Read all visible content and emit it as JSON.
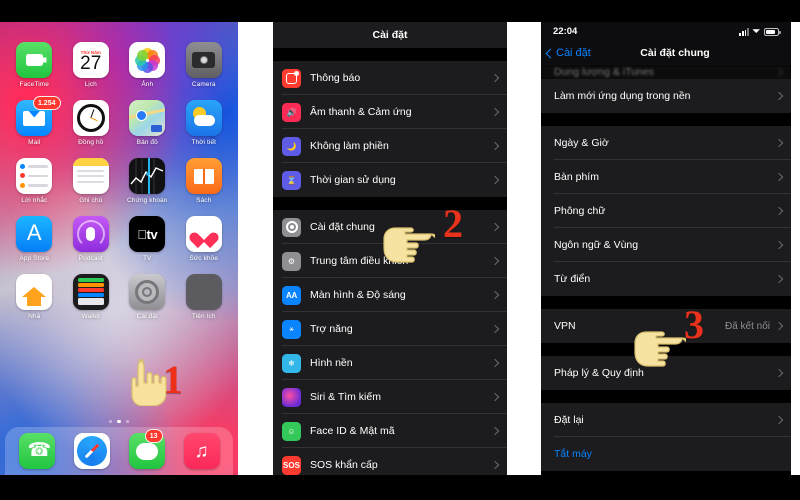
{
  "panel1": {
    "name": "iphone-home-screen",
    "status": {
      "time": ""
    },
    "apps": [
      {
        "label": "FaceTime",
        "icon": "facetime-icon",
        "badge": ""
      },
      {
        "label": "Lịch",
        "icon": "calendar-icon",
        "badge": "",
        "cal_weekday": "Thứ Năm",
        "cal_day": "27"
      },
      {
        "label": "Ảnh",
        "icon": "photos-icon",
        "badge": ""
      },
      {
        "label": "Camera",
        "icon": "camera-icon",
        "badge": ""
      },
      {
        "label": "Mail",
        "icon": "mail-icon",
        "badge": "1.254"
      },
      {
        "label": "Đồng hồ",
        "icon": "clock-icon",
        "badge": ""
      },
      {
        "label": "Bản đồ",
        "icon": "maps-icon",
        "badge": ""
      },
      {
        "label": "Thời tiết",
        "icon": "weather-icon",
        "badge": ""
      },
      {
        "label": "Lời nhắc",
        "icon": "reminders-icon",
        "badge": ""
      },
      {
        "label": "Ghi chú",
        "icon": "notes-icon",
        "badge": ""
      },
      {
        "label": "Chứng khoán",
        "icon": "stocks-icon",
        "badge": ""
      },
      {
        "label": "Sách",
        "icon": "books-icon",
        "badge": ""
      },
      {
        "label": "App Store",
        "icon": "app-store-icon",
        "badge": ""
      },
      {
        "label": "Podcast",
        "icon": "podcasts-icon",
        "badge": ""
      },
      {
        "label": "TV",
        "icon": "apple-tv-icon",
        "badge": ""
      },
      {
        "label": "Sức khỏe",
        "icon": "health-icon",
        "badge": ""
      },
      {
        "label": "Nhà",
        "icon": "home-app-icon",
        "badge": ""
      },
      {
        "label": "Wallet",
        "icon": "wallet-icon",
        "badge": ""
      },
      {
        "label": "Cài đặt",
        "icon": "settings-gear-icon",
        "badge": ""
      },
      {
        "label": "Tiện ích",
        "icon": "utilities-folder-icon",
        "badge": ""
      }
    ],
    "page_dots": {
      "count": 3,
      "active_index": 1
    },
    "dock": [
      {
        "label": "Điện thoại",
        "icon": "phone-icon",
        "badge": ""
      },
      {
        "label": "Safari",
        "icon": "safari-icon",
        "badge": ""
      },
      {
        "label": "Tin nhắn",
        "icon": "messages-icon",
        "badge": "13"
      },
      {
        "label": "Nhạc",
        "icon": "music-icon",
        "badge": ""
      }
    ],
    "step": {
      "number": "1"
    }
  },
  "panel2": {
    "name": "settings-main-screen",
    "navbar": {
      "title": "Cài đặt"
    },
    "groups": [
      {
        "rows": [
          {
            "label": "Thông báo",
            "icon": "notifications-icon",
            "value": ""
          },
          {
            "label": "Âm thanh & Cảm ứng",
            "icon": "sounds-haptics-icon",
            "value": ""
          },
          {
            "label": "Không làm phiền",
            "icon": "do-not-disturb-icon",
            "value": ""
          },
          {
            "label": "Thời gian sử dụng",
            "icon": "screen-time-icon",
            "value": ""
          }
        ]
      },
      {
        "rows": [
          {
            "label": "Cài đặt chung",
            "icon": "general-settings-icon",
            "value": ""
          },
          {
            "label": "Trung tâm điều khiển",
            "icon": "control-center-icon",
            "value": ""
          },
          {
            "label": "Màn hình & Độ sáng",
            "icon": "display-brightness-icon",
            "value": ""
          },
          {
            "label": "Trợ năng",
            "icon": "accessibility-icon",
            "value": ""
          },
          {
            "label": "Hình nền",
            "icon": "wallpaper-icon",
            "value": ""
          },
          {
            "label": "Siri & Tìm kiếm",
            "icon": "siri-search-icon",
            "value": ""
          },
          {
            "label": "Face ID & Mật mã",
            "icon": "face-id-passcode-icon",
            "value": ""
          },
          {
            "label": "SOS khẩn cấp",
            "icon": "emergency-sos-icon",
            "value": ""
          }
        ]
      }
    ],
    "step": {
      "number": "2"
    }
  },
  "panel3": {
    "name": "general-settings-screen",
    "status": {
      "time": "22:04"
    },
    "navbar": {
      "back_label": "Cài đặt",
      "title": "Cài đặt chung"
    },
    "groups": [
      {
        "rows": [
          {
            "label": "Dung lượng & iTunes",
            "value": "",
            "faded": true
          },
          {
            "label": "Làm mới ứng dụng trong nền",
            "value": ""
          }
        ]
      },
      {
        "rows": [
          {
            "label": "Ngày & Giờ",
            "value": ""
          },
          {
            "label": "Bàn phím",
            "value": ""
          },
          {
            "label": "Phông chữ",
            "value": ""
          },
          {
            "label": "Ngôn ngữ & Vùng",
            "value": ""
          },
          {
            "label": "Từ điển",
            "value": ""
          }
        ]
      },
      {
        "rows": [
          {
            "label": "VPN",
            "value": "Đã kết nối"
          }
        ]
      },
      {
        "rows": [
          {
            "label": "Pháp lý & Quy định",
            "value": ""
          }
        ]
      },
      {
        "rows": [
          {
            "label": "Đặt lại",
            "value": ""
          },
          {
            "label": "Tắt máy",
            "value": "",
            "blue": true
          }
        ]
      }
    ],
    "step": {
      "number": "3"
    }
  },
  "colors": {
    "step_number": "#e8321c",
    "hand_fill": "#f7e3a1",
    "accent_blue": "#0a84ff",
    "row_bg": "#1c1c1e",
    "page_bg": "#000000",
    "secondary_text": "#8e8e93"
  }
}
